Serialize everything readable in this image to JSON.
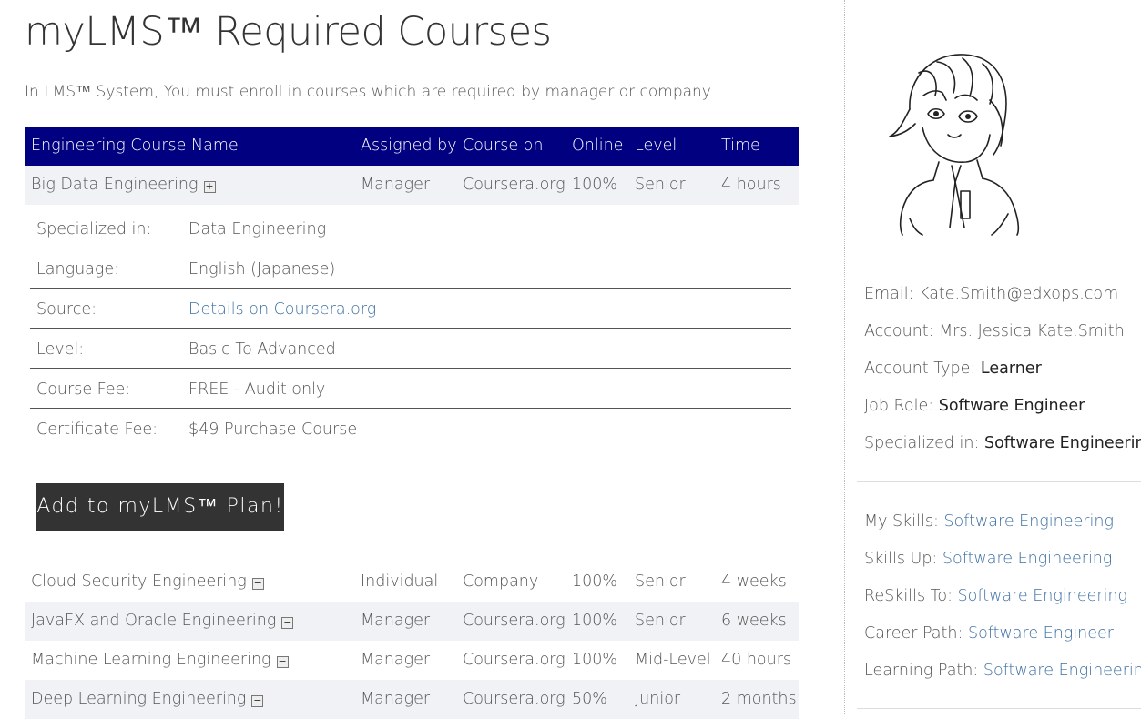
{
  "page": {
    "title": "myLMS™ Required Courses",
    "intro": "In LMS™ System, You must enroll in courses which are required by manager or company."
  },
  "table": {
    "headers": {
      "name": "Engineering Course Name",
      "assigned": "Assigned by",
      "on": "Course on",
      "online": "Online",
      "level": "Level",
      "time": "Time"
    },
    "expanded_course": {
      "name": "Big Data Engineering",
      "toggle": "+",
      "assigned": "Manager",
      "on": "Coursera.org",
      "online": "100%",
      "level": "Senior",
      "time": "4 hours"
    },
    "details": [
      {
        "label": "Specialized in:",
        "value": "Data Engineering"
      },
      {
        "label": "Language:",
        "value": "English (Japanese)"
      },
      {
        "label": "Source:",
        "value": "Details on Coursera.org"
      },
      {
        "label": "Level:",
        "value": "Basic To Advanced"
      },
      {
        "label": "Course Fee:",
        "value": "FREE - Audit only"
      },
      {
        "label": "Certificate Fee:",
        "value": "$49 Purchase Course"
      }
    ],
    "add_button": "Add to myLMS™ Plan!",
    "courses": [
      {
        "name": "Cloud Security Engineering",
        "toggle": "−",
        "assigned": "Individual",
        "on": "Company",
        "online": "100%",
        "level": "Senior",
        "time": "4 weeks"
      },
      {
        "name": "JavaFX and Oracle Engineering",
        "toggle": "−",
        "assigned": "Manager",
        "on": "Coursera.org",
        "online": "100%",
        "level": "Senior",
        "time": "6 weeks"
      },
      {
        "name": "Machine Learning Engineering",
        "toggle": "−",
        "assigned": "Manager",
        "on": "Coursera.org",
        "online": "100%",
        "level": "Mid-Level",
        "time": "40 hours"
      },
      {
        "name": "Deep Learning Engineering",
        "toggle": "−",
        "assigned": "Manager",
        "on": "Coursera.org",
        "online": "50%",
        "level": "Junior",
        "time": "2 months"
      }
    ]
  },
  "profile": {
    "email_label": "Email:",
    "email": "Kate.Smith@edxops.com",
    "account_label": "Account:",
    "account": "Mrs. Jessica Kate.Smith",
    "account_type_label": "Account Type:",
    "account_type": "Learner",
    "job_role_label": "Job Role:",
    "job_role": "Software Engineer",
    "specialized_label": "Specialized in:",
    "specialized": "Software Engineering",
    "my_skills_label": "My Skills:",
    "my_skills": "Software Engineering",
    "skills_up_label": "Skills Up:",
    "skills_up": "Software Engineering",
    "reskills_label": "ReSkills To:",
    "reskills": "Software Engineering",
    "career_path_label": "Career Path:",
    "career_path": "Software Engineer",
    "learning_path_label": "Learning Path:",
    "learning_path": "Software Engineering"
  },
  "colors": {
    "header_bg": "#000080",
    "link": "#3d6fa3",
    "button_bg": "#333333",
    "alt_row": "#f0f2f5"
  }
}
